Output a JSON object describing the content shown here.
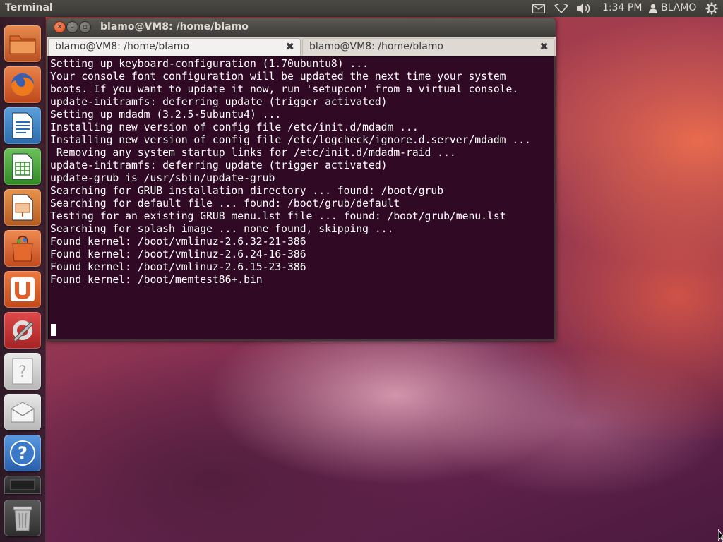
{
  "top_panel": {
    "app_title": "Terminal",
    "clock": "1:34 PM",
    "username": "BLAMO",
    "icons": [
      "mail-icon",
      "wifi-icon",
      "volume-icon",
      "user-icon",
      "gear-icon"
    ]
  },
  "launcher": {
    "items": [
      {
        "name": "home-folder-icon",
        "color": "#e0703a"
      },
      {
        "name": "firefox-icon",
        "color": "#e2683a"
      },
      {
        "name": "libreoffice-writer-icon",
        "color": "#3a86c8"
      },
      {
        "name": "libreoffice-calc-icon",
        "color": "#4aa33a"
      },
      {
        "name": "libreoffice-impress-icon",
        "color": "#d8743a"
      },
      {
        "name": "software-center-icon",
        "color": "#e0603a"
      },
      {
        "name": "ubuntu-one-icon",
        "color": "#e25f2c"
      },
      {
        "name": "system-settings-icon",
        "color": "#c83232"
      },
      {
        "name": "unknown-app-icon",
        "color": "#cfcfcf"
      },
      {
        "name": "mail-app-icon",
        "color": "#cfcfcf"
      },
      {
        "name": "help-icon",
        "color": "#3a78c8"
      },
      {
        "name": "workspace-switcher-icon",
        "color": "#333333"
      },
      {
        "name": "trash-icon",
        "color": "#666666"
      }
    ]
  },
  "window": {
    "title": "blamo@VM8: /home/blamo",
    "tabs": [
      {
        "label": "blamo@VM8: /home/blamo",
        "active": true
      },
      {
        "label": "blamo@VM8: /home/blamo",
        "active": false
      }
    ],
    "close_glyph": "✖",
    "output_lines": [
      "Setting up keyboard-configuration (1.70ubuntu8) ...",
      "Your console font configuration will be updated the next time your system",
      "boots. If you want to update it now, run 'setupcon' from a virtual console.",
      "update-initramfs: deferring update (trigger activated)",
      "Setting up mdadm (3.2.5-5ubuntu4) ...",
      "Installing new version of config file /etc/init.d/mdadm ...",
      "Installing new version of config file /etc/logcheck/ignore.d.server/mdadm ...",
      " Removing any system startup links for /etc/init.d/mdadm-raid ...",
      "update-initramfs: deferring update (trigger activated)",
      "update-grub is /usr/sbin/update-grub",
      "Searching for GRUB installation directory ... found: /boot/grub",
      "Searching for default file ... found: /boot/grub/default",
      "Testing for an existing GRUB menu.lst file ... found: /boot/grub/menu.lst",
      "Searching for splash image ... none found, skipping ...",
      "Found kernel: /boot/vmlinuz-2.6.32-21-386",
      "Found kernel: /boot/vmlinuz-2.6.24-16-386",
      "Found kernel: /boot/vmlinuz-2.6.15-23-386",
      "Found kernel: /boot/memtest86+.bin"
    ],
    "background_color": "#300a24",
    "text_color": "#ffffff"
  }
}
